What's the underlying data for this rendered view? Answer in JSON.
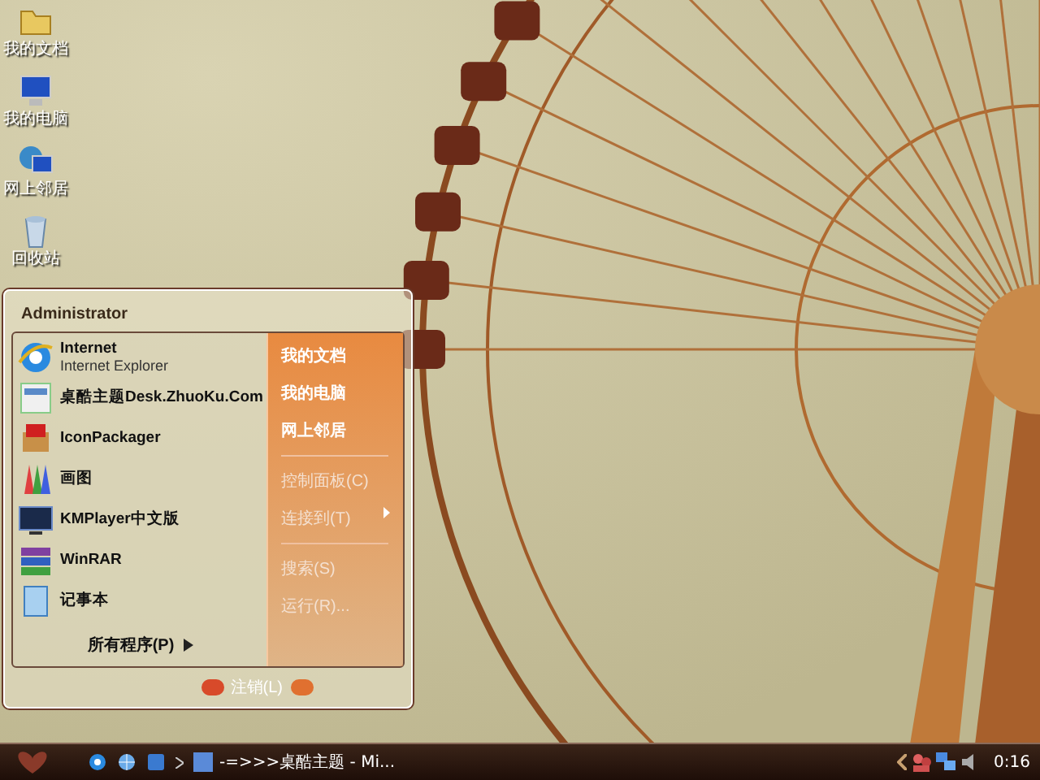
{
  "desktop_icons": [
    {
      "label": "我的文档",
      "kind": "folder"
    },
    {
      "label": "我的电脑",
      "kind": "computer"
    },
    {
      "label": "网上邻居",
      "kind": "network"
    },
    {
      "label": "回收站",
      "kind": "recycle"
    }
  ],
  "start_menu": {
    "user": "Administrator",
    "pinned": [
      {
        "title": "Internet",
        "subtitle": "Internet Explorer",
        "kind": "ie"
      },
      {
        "title": "桌酷主题Desk.ZhuoKu.Com",
        "kind": "theme"
      },
      {
        "title": "IconPackager",
        "kind": "package"
      },
      {
        "title": "画图",
        "kind": "paint"
      },
      {
        "title": "KMPlayer中文版",
        "kind": "player"
      },
      {
        "title": "WinRAR",
        "kind": "archive"
      },
      {
        "title": "记事本",
        "kind": "notepad"
      }
    ],
    "all_programs": "所有程序(P)",
    "places": [
      [
        {
          "label": "我的文档",
          "submenu": false
        },
        {
          "label": "我的电脑",
          "submenu": false
        },
        {
          "label": "网上邻居",
          "submenu": false
        }
      ],
      [
        {
          "label": "控制面板(C)",
          "submenu": false
        },
        {
          "label": "连接到(T)",
          "submenu": true
        }
      ],
      [
        {
          "label": "搜索(S)",
          "submenu": false
        },
        {
          "label": "运行(R)...",
          "submenu": false
        }
      ]
    ],
    "log_off": "注销(L)"
  },
  "taskbar": {
    "task": "-=>>>桌酷主题 - Mi...",
    "clock": "0:16"
  }
}
